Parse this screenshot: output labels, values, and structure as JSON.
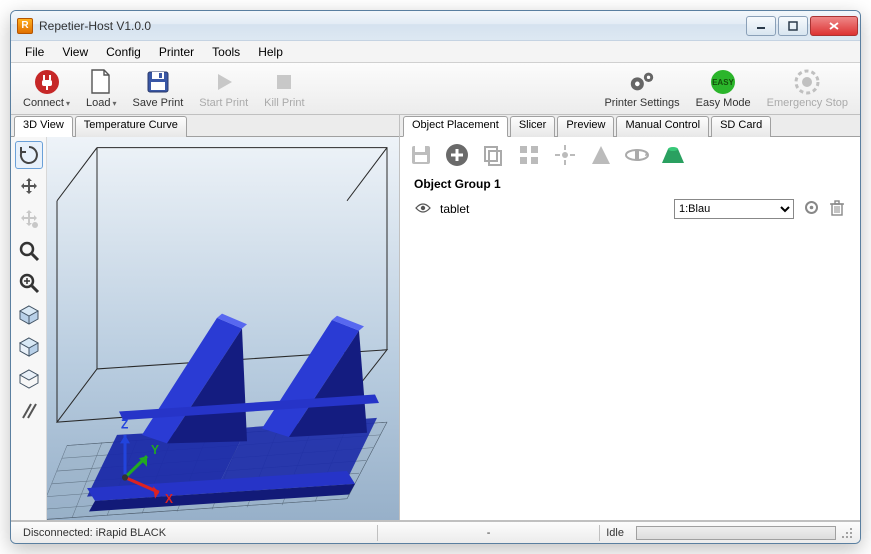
{
  "window": {
    "title": "Repetier-Host V1.0.0",
    "app_icon_letter": "R"
  },
  "menu": {
    "items": [
      "File",
      "View",
      "Config",
      "Printer",
      "Tools",
      "Help"
    ]
  },
  "toolbar": {
    "connect": "Connect",
    "load": "Load",
    "save_print": "Save Print",
    "start_print": "Start Print",
    "kill_print": "Kill Print",
    "printer_settings": "Printer Settings",
    "easy_mode": "Easy Mode",
    "emergency_stop": "Emergency Stop",
    "easy_badge": "EASY"
  },
  "left": {
    "tabs": {
      "view3d": "3D View",
      "temp": "Temperature Curve"
    },
    "active_tab": "view3d",
    "axes": {
      "x": "X",
      "y": "Y",
      "z": "Z"
    }
  },
  "right": {
    "tabs": {
      "object_placement": "Object Placement",
      "slicer": "Slicer",
      "preview": "Preview",
      "manual_control": "Manual Control",
      "sd_card": "SD Card"
    },
    "active_tab": "object_placement",
    "group_title": "Object Group 1",
    "objects": [
      {
        "name": "tablet",
        "material": "1:Blau"
      }
    ],
    "material_options": [
      "1:Blau"
    ]
  },
  "status": {
    "connection": "Disconnected: iRapid BLACK",
    "middle": "-",
    "state": "Idle"
  }
}
